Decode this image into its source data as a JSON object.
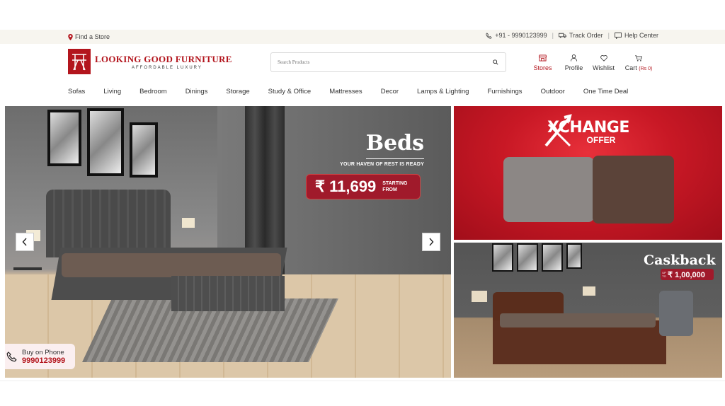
{
  "topbar": {
    "find_store": "Find a Store",
    "phone": "+91 - 9990123999",
    "track_order": "Track Order",
    "help_center": "Help Center"
  },
  "header": {
    "brand_name": "LOOKING GOOD FURNITURE",
    "brand_tagline": "AFFORDABLE LUXURY",
    "search_placeholder": "Search Products",
    "actions": {
      "stores": "Stores",
      "profile": "Profile",
      "wishlist": "Wishlist",
      "cart": "Cart",
      "cart_count": "(Rs 0)"
    }
  },
  "nav": {
    "items": [
      "Sofas",
      "Living",
      "Bedroom",
      "Dinings",
      "Storage",
      "Study & Office",
      "Mattresses",
      "Decor",
      "Lamps & Lighting",
      "Furnishings",
      "Outdoor",
      "One Time Deal"
    ]
  },
  "hero": {
    "title": "Beds",
    "subtitle": "YOUR HAVEN OF REST IS READY",
    "price": "₹ 11,699",
    "price_suffix_1": "STARTING",
    "price_suffix_2": "FROM",
    "buy_on_phone_label": "Buy on Phone",
    "buy_on_phone_number": "9990123999"
  },
  "promo_exchange": {
    "title": "XCHANGE",
    "subtitle": "OFFER"
  },
  "promo_cashback": {
    "title": "Caskback",
    "badge_prefix_1": "UP",
    "badge_prefix_2": "TO",
    "amount": "₹ 1,00,000"
  },
  "colors": {
    "brand": "#b3151d",
    "badge": "#a01a2b",
    "topbar_bg": "#f7f5ef"
  }
}
